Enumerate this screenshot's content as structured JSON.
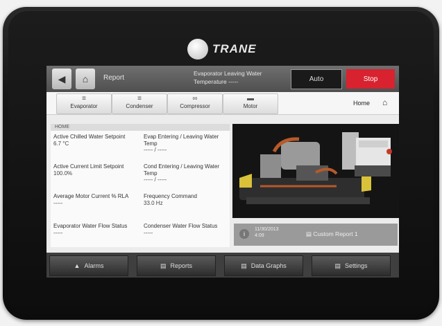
{
  "brand": {
    "name": "TRANE"
  },
  "header": {
    "nav_title": "Report",
    "evap_line1": "Evaporator Leaving Water",
    "evap_line2": "Temperature -----",
    "auto_label": "Auto",
    "stop_label": "Stop",
    "stop_color": "#d8222f"
  },
  "tabs": [
    {
      "label": "Evaporator",
      "icon": "evaporator-icon"
    },
    {
      "label": "Condenser",
      "icon": "condenser-icon"
    },
    {
      "label": "Compressor",
      "icon": "compressor-icon"
    },
    {
      "label": "Motor",
      "icon": "motor-icon"
    }
  ],
  "home": {
    "label": "Home",
    "icon": "home-icon"
  },
  "section": {
    "title": "HOME"
  },
  "fields": [
    {
      "label": "Active Chilled Water Setpoint",
      "value": "6.7 °C"
    },
    {
      "label": "Evap Entering / Leaving Water Temp",
      "value": "----- / -----"
    },
    {
      "label": "Active Current Limit Setpoint",
      "value": "100.0%"
    },
    {
      "label": "Cond Entering / Leaving Water Temp",
      "value": "----- / -----"
    },
    {
      "label": "Average Motor Current % RLA",
      "value": "-----"
    },
    {
      "label": "Frequency Command",
      "value": "33.0 Hz"
    },
    {
      "label": "Evaporator Water Flow Status",
      "value": "-----"
    },
    {
      "label": "Condenser Water Flow Status",
      "value": "-----"
    }
  ],
  "status_bar": {
    "date": "11/30/2013",
    "time": "4:09",
    "report_label": "Custom Report 1"
  },
  "bottom_nav": [
    {
      "label": "Alarms",
      "icon": "alarm-icon"
    },
    {
      "label": "Reports",
      "icon": "report-icon"
    },
    {
      "label": "Data Graphs",
      "icon": "graph-icon"
    },
    {
      "label": "Settings",
      "icon": "settings-icon"
    }
  ]
}
